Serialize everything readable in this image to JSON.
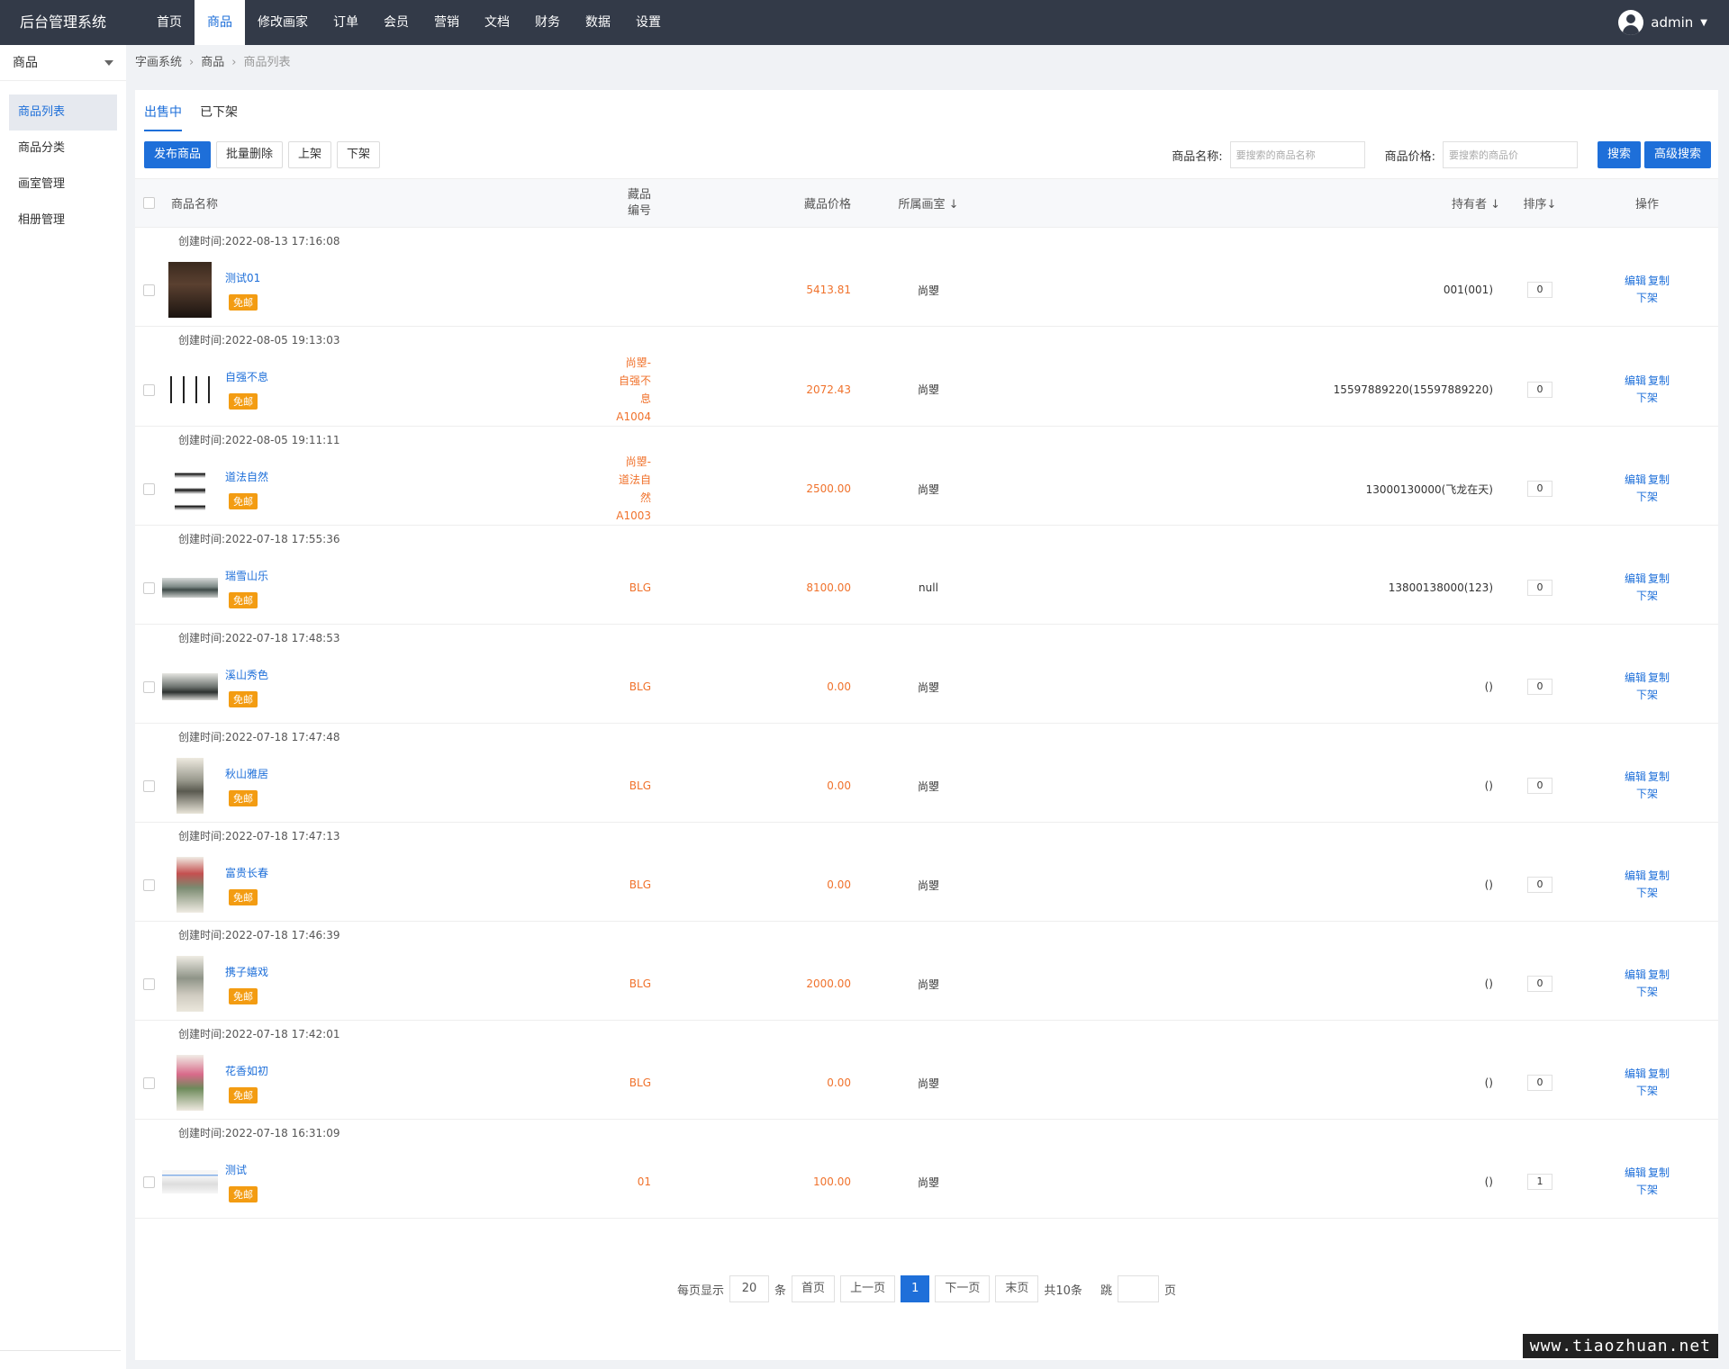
{
  "app": {
    "title": "后台管理系统"
  },
  "topnav": [
    {
      "label": "首页",
      "active": false
    },
    {
      "label": "商品",
      "active": true
    },
    {
      "label": "修改画家",
      "active": false
    },
    {
      "label": "订单",
      "active": false
    },
    {
      "label": "会员",
      "active": false
    },
    {
      "label": "营销",
      "active": false
    },
    {
      "label": "文档",
      "active": false
    },
    {
      "label": "财务",
      "active": false
    },
    {
      "label": "数据",
      "active": false
    },
    {
      "label": "设置",
      "active": false
    }
  ],
  "user": {
    "name": "admin"
  },
  "sidebar": {
    "header": "商品",
    "items": [
      {
        "label": "商品列表",
        "active": true
      },
      {
        "label": "商品分类",
        "active": false
      },
      {
        "label": "画室管理",
        "active": false
      },
      {
        "label": "相册管理",
        "active": false
      }
    ]
  },
  "breadcrumb": [
    "字画系统",
    "商品",
    "商品列表"
  ],
  "tabs": [
    {
      "label": "出售中",
      "active": true
    },
    {
      "label": "已下架",
      "active": false
    }
  ],
  "toolbar": {
    "publish": "发布商品",
    "batch_delete": "批量删除",
    "on_shelf": "上架",
    "off_shelf": "下架"
  },
  "search": {
    "name_label": "商品名称:",
    "name_placeholder": "要搜索的商品名称",
    "price_label": "商品价格:",
    "price_placeholder": "要搜索的商品价",
    "search_btn": "搜索",
    "advanced_btn": "高级搜索"
  },
  "table": {
    "headers": {
      "name": "商品名称",
      "code_line1": "藏品",
      "code_line2": "编号",
      "price": "藏品价格",
      "studio": "所属画室 ↓",
      "owner": "持有者 ↓",
      "sort": "排序↓",
      "ops": "操作"
    },
    "created_prefix": "创建时间:",
    "free_shipping": "免邮",
    "op_edit": "编辑",
    "op_copy": "复制",
    "op_off": "下架",
    "rows": [
      {
        "created": "2022-08-13 17:16:08",
        "name": "测试01",
        "thumb": "portrait",
        "code": "",
        "price": "5413.81",
        "studio": "尚曌",
        "owner": "001(001)",
        "sort": "0"
      },
      {
        "created": "2022-08-05 19:13:03",
        "name": "自强不息",
        "thumb": "callig",
        "code": "尚曌-\n自强不\n息\nA1004",
        "price": "2072.43",
        "studio": "尚曌",
        "owner": "15597889220(15597889220)",
        "sort": "0"
      },
      {
        "created": "2022-08-05 19:11:11",
        "name": "道法自然",
        "thumb": "callig2",
        "code": "尚曌-\n道法自\n然\nA1003",
        "price": "2500.00",
        "studio": "尚曌",
        "owner": "13000130000(飞龙在天)",
        "sort": "0"
      },
      {
        "created": "2022-07-18 17:55:36",
        "name": "瑞雪山乐",
        "thumb": "landscape",
        "code": "BLG",
        "price": "8100.00",
        "studio": "null",
        "owner": "13800138000(123)",
        "sort": "0"
      },
      {
        "created": "2022-07-18 17:48:53",
        "name": "溪山秀色",
        "thumb": "land2",
        "code": "BLG",
        "price": "0.00",
        "studio": "尚曌",
        "owner": "()",
        "sort": "0"
      },
      {
        "created": "2022-07-18 17:47:48",
        "name": "秋山雅居",
        "thumb": "scroll1",
        "code": "BLG",
        "price": "0.00",
        "studio": "尚曌",
        "owner": "()",
        "sort": "0"
      },
      {
        "created": "2022-07-18 17:47:13",
        "name": "富贵长春",
        "thumb": "scroll2",
        "code": "BLG",
        "price": "0.00",
        "studio": "尚曌",
        "owner": "()",
        "sort": "0"
      },
      {
        "created": "2022-07-18 17:46:39",
        "name": "携子嬉戏",
        "thumb": "scroll3",
        "code": "BLG",
        "price": "2000.00",
        "studio": "尚曌",
        "owner": "()",
        "sort": "0"
      },
      {
        "created": "2022-07-18 17:42:01",
        "name": "花香如初",
        "thumb": "scroll4",
        "code": "BLG",
        "price": "0.00",
        "studio": "尚曌",
        "owner": "()",
        "sort": "0"
      },
      {
        "created": "2022-07-18 16:31:09",
        "name": "测试",
        "thumb": "screen",
        "code": "01",
        "price": "100.00",
        "studio": "尚曌",
        "owner": "()",
        "sort": "1"
      }
    ]
  },
  "pagination": {
    "per_page_label": "每页显示",
    "per_page": "20",
    "unit": "条",
    "first": "首页",
    "prev": "上一页",
    "current": "1",
    "next": "下一页",
    "last": "末页",
    "total": "共10条",
    "jump_label": "跳",
    "page_unit": "页"
  },
  "watermark": "www.tiaozhuan.net"
}
